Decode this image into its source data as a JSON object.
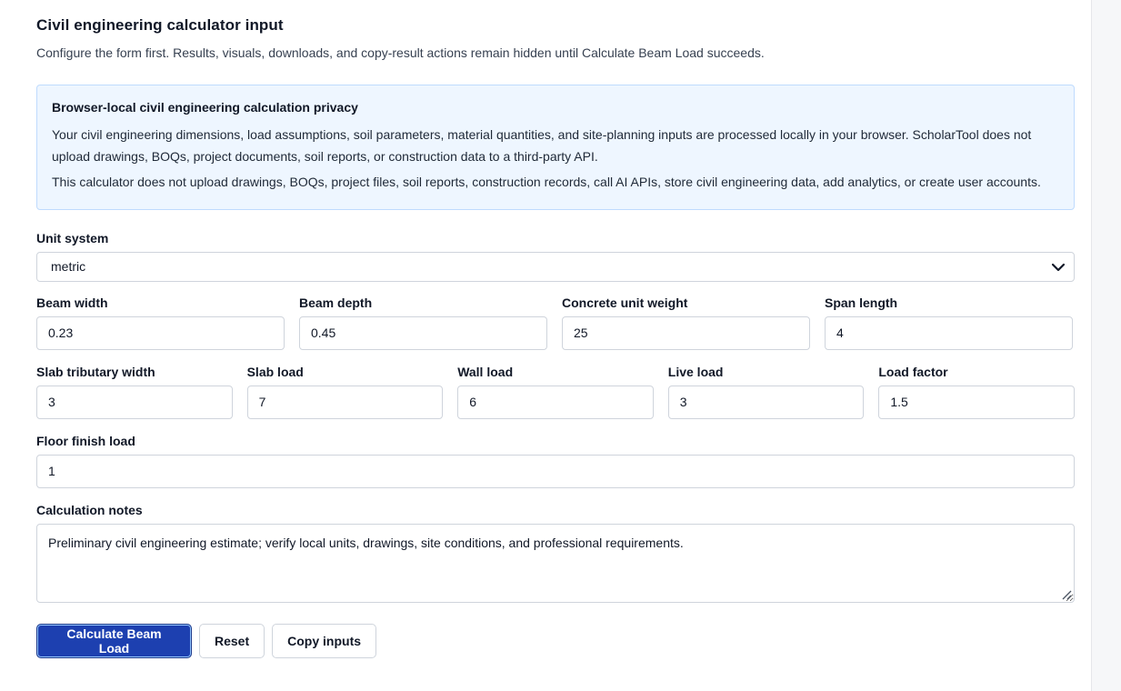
{
  "header": {
    "title": "Civil engineering calculator input",
    "subtitle": "Configure the form first. Results, visuals, downloads, and copy-result actions remain hidden until Calculate Beam Load succeeds."
  },
  "privacy": {
    "title": "Browser-local civil engineering calculation privacy",
    "paragraph1": "Your civil engineering dimensions, load assumptions, soil parameters, material quantities, and site-planning inputs are processed locally in your browser. ScholarTool does not upload drawings, BOQs, project documents, soil reports, or construction data to a third-party API.",
    "paragraph2": "This calculator does not upload drawings, BOQs, project files, soil reports, construction records, call AI APIs, store civil engineering data, add analytics, or create user accounts."
  },
  "form": {
    "unit_system": {
      "label": "Unit system",
      "value": "metric"
    },
    "beam_width": {
      "label": "Beam width",
      "value": "0.23"
    },
    "beam_depth": {
      "label": "Beam depth",
      "value": "0.45"
    },
    "concrete_unit_weight": {
      "label": "Concrete unit weight",
      "value": "25"
    },
    "span_length": {
      "label": "Span length",
      "value": "4"
    },
    "slab_tributary_width": {
      "label": "Slab tributary width",
      "value": "3"
    },
    "slab_load": {
      "label": "Slab load",
      "value": "7"
    },
    "wall_load": {
      "label": "Wall load",
      "value": "6"
    },
    "live_load": {
      "label": "Live load",
      "value": "3"
    },
    "load_factor": {
      "label": "Load factor",
      "value": "1.5"
    },
    "floor_finish_load": {
      "label": "Floor finish load",
      "value": "1"
    },
    "calculation_notes": {
      "label": "Calculation notes",
      "value": "Preliminary civil engineering estimate; verify local units, drawings, site conditions, and professional requirements."
    }
  },
  "actions": {
    "calculate_label": "Calculate Beam Load",
    "reset_label": "Reset",
    "copy_label": "Copy inputs"
  },
  "icons": {
    "select_chevron": "chevron-down-icon",
    "resize_grip": "resize-grip-icon"
  },
  "colors": {
    "primary": "#1d40b0",
    "privacy_bg": "#eef6ff",
    "privacy_border": "#bfdbfe"
  }
}
